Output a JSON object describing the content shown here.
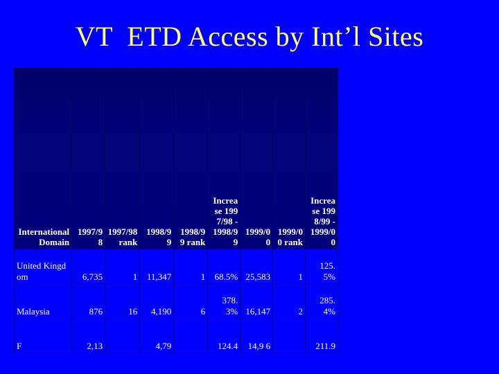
{
  "slide": {
    "title": "VT  ETD Access by Int’l Sites",
    "title_color": "#FFFF66",
    "background_color": "#0000FF",
    "table_header_background": "#000080"
  },
  "table": {
    "headers": [
      "International Domain",
      "1997/98",
      "1997/98 rank",
      "1998/99",
      "1998/99 rank",
      "Increase 1997/98 - 1998/99",
      "1999/00",
      "1999/00 rank",
      "Increase 1998/99 - 1999/00"
    ],
    "rows": [
      {
        "domain": "United Kingdom",
        "y1997_98": "6,735",
        "rank_1997_98": "1",
        "y1998_99": "11,347",
        "rank_1998_99": "1",
        "increase_98_99": "68.5%",
        "y1999_00": "25,583",
        "rank_1999_00": "1",
        "increase_99_00": "125.5%"
      },
      {
        "domain": "Malaysia",
        "y1997_98": "876",
        "rank_1997_98": "16",
        "y1998_99": "4,190",
        "rank_1998_99": "6",
        "increase_98_99": "378.3%",
        "y1999_00": "16,147",
        "rank_1999_00": "2",
        "increase_99_00": "285.4%"
      },
      {
        "domain": "F",
        "y1997_98": "2,13",
        "rank_1997_98": "",
        "y1998_99": "4,79",
        "rank_1998_99": "",
        "increase_98_99": "124.4",
        "y1999_00": "14,9 6",
        "rank_1999_00": "",
        "increase_99_00": "211.9"
      }
    ]
  }
}
